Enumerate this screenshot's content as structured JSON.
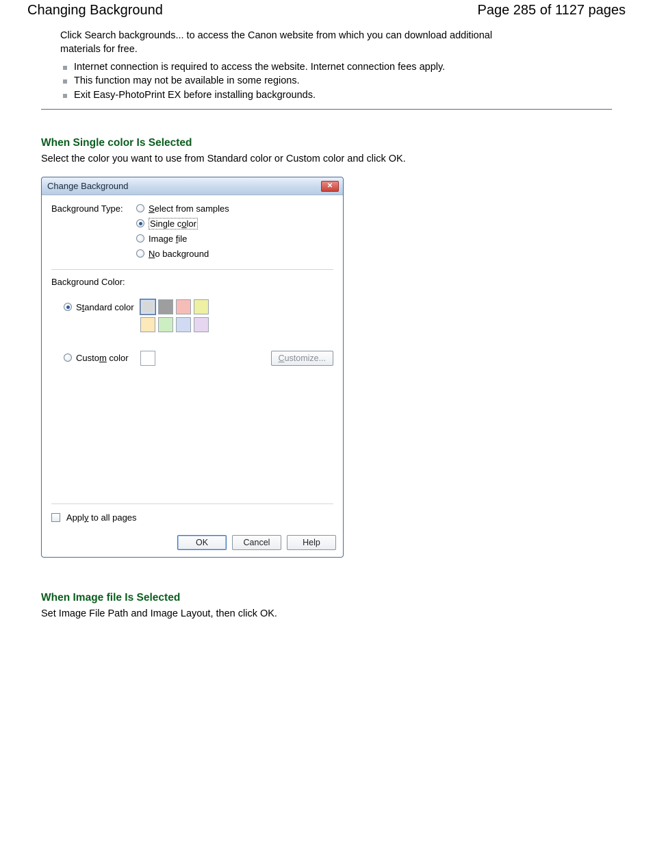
{
  "header": {
    "title": "Changing Background",
    "page_info": "Page 285 of 1127 pages"
  },
  "intro": "Click Search backgrounds... to access the Canon website from which you can download additional materials for free.",
  "notes": [
    "Internet connection is required to access the website. Internet connection fees apply.",
    "This function may not be available in some regions.",
    "Exit Easy-PhotoPrint EX before installing backgrounds."
  ],
  "section_single": {
    "title": "When Single color Is Selected",
    "desc": "Select the color you want to use from Standard color or Custom color and click OK."
  },
  "section_image": {
    "title": "When Image file Is Selected",
    "desc": "Set Image File Path and Image Layout, then click OK."
  },
  "dialog": {
    "title": "Change Background",
    "labels": {
      "background_type": "Background Type:",
      "background_color": "Background Color:",
      "apply_all": "Apply to all pages"
    },
    "type_options": {
      "samples_pre": "S",
      "samples_post": "elect from samples",
      "single_pre": "Single c",
      "single_u": "o",
      "single_post": "lor",
      "image_pre": "Image ",
      "image_u": "f",
      "image_post": "ile",
      "nobg_pre": "",
      "nobg_u": "N",
      "nobg_post": "o background"
    },
    "color_mode": {
      "standard_pre": "S",
      "standard_u": "t",
      "standard_post": "andard color",
      "custom_pre": "Custo",
      "custom_u": "m",
      "custom_post": " color"
    },
    "swatches": [
      "#d8d8d8",
      "#9e9e9e",
      "#f6bdb8",
      "#eef0a4",
      "#fce8b8",
      "#cdeec2",
      "#d0daf2",
      "#e6d6ef"
    ],
    "buttons": {
      "customize": "Customize...",
      "ok": "OK",
      "cancel": "Cancel",
      "help": "Help"
    },
    "apply_underline": "y"
  }
}
